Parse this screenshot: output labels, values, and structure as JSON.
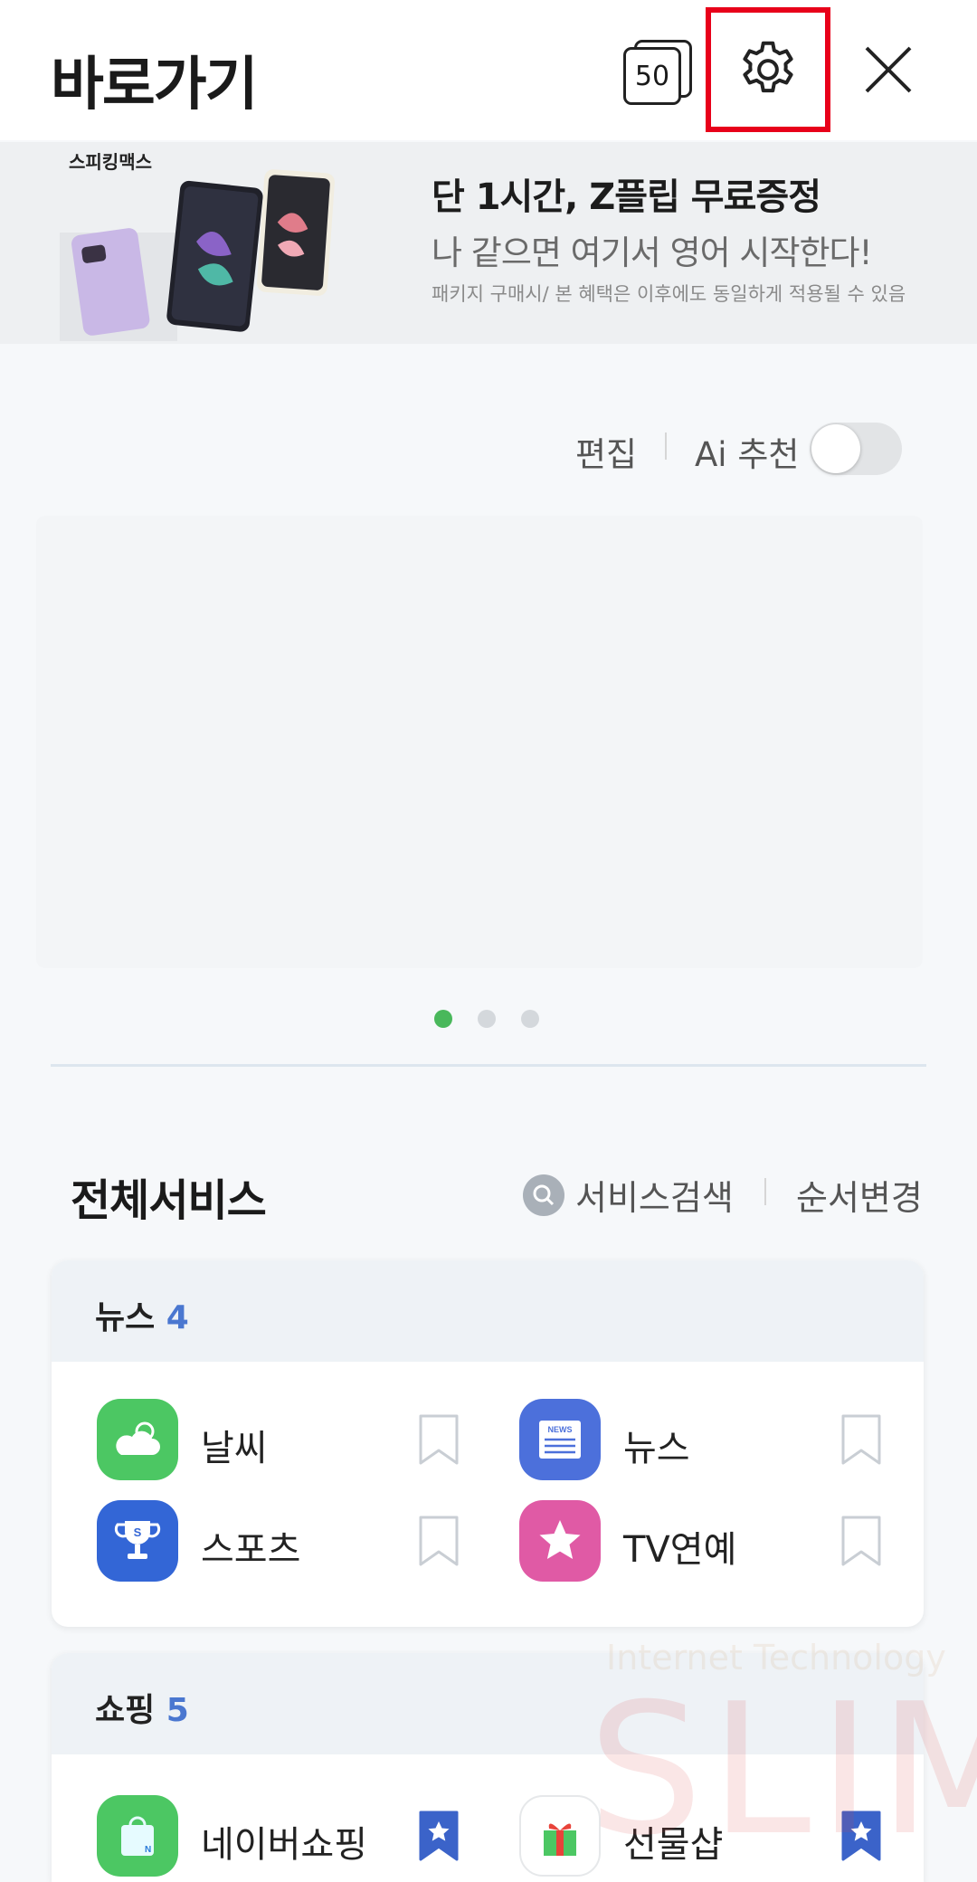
{
  "header": {
    "title": "바로가기",
    "tab_count": "50"
  },
  "banner": {
    "brand": "스피킹맥스",
    "title": "단 1시간, Z플립 무료증정",
    "subtitle": "나 같으면 여기서 영어 시작한다!",
    "note": "패키지 구매시/ 본 혜택은 이후에도 동일하게 적용될 수 있음"
  },
  "controls": {
    "edit_label": "편집",
    "ai_label": "Ai 추천",
    "ai_toggle_on": false
  },
  "carousel": {
    "page_count": 3,
    "active_page": 1
  },
  "all_services": {
    "title": "전체서비스",
    "search_label": "서비스검색",
    "reorder_label": "순서변경"
  },
  "sections": [
    {
      "name": "뉴스",
      "count": "4",
      "items": [
        {
          "label": "날씨",
          "icon": "weather-icon",
          "bookmarked": false
        },
        {
          "label": "뉴스",
          "icon": "news-icon",
          "bookmarked": false
        },
        {
          "label": "스포츠",
          "icon": "trophy-icon",
          "bookmarked": false
        },
        {
          "label": "TV연예",
          "icon": "star-icon",
          "bookmarked": false
        }
      ]
    },
    {
      "name": "쇼핑",
      "count": "5",
      "items": [
        {
          "label": "네이버쇼핑",
          "icon": "shopping-bag-icon",
          "bookmarked": true
        },
        {
          "label": "선물샵",
          "icon": "gift-icon",
          "bookmarked": true
        }
      ]
    }
  ],
  "watermark": {
    "line1": "Internet Technology",
    "line2": "SLIM"
  },
  "colors": {
    "accent_green": "#49b85b",
    "count_blue": "#4a77d0",
    "highlight_red": "#e8001a"
  }
}
